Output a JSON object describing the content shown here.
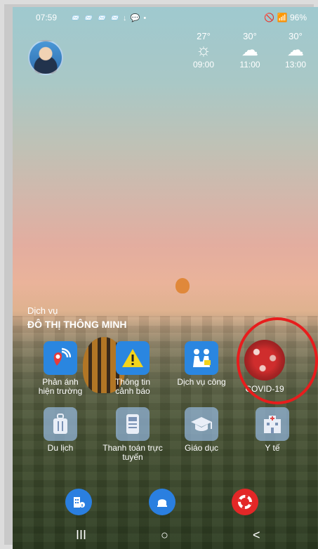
{
  "status_bar": {
    "time": "07:59",
    "notifications": "📨 📨 📨 📨 ↓ 💬 •",
    "right": "🚫 📶 96%"
  },
  "weather": [
    {
      "temp": "27°",
      "icon": "☼",
      "hour": "09:00"
    },
    {
      "temp": "30°",
      "icon": "☁",
      "hour": "11:00"
    },
    {
      "temp": "30°",
      "icon": "☁",
      "hour": "13:00"
    }
  ],
  "services": {
    "label": "Dịch vụ",
    "title": "ĐÔ THỊ THÔNG MINH",
    "row1": [
      {
        "label": "Phản ánh hiện trường",
        "icon": "location-signal-icon"
      },
      {
        "label": "Thông tin cảnh báo",
        "icon": "warning-icon"
      },
      {
        "label": "Dịch vụ công",
        "icon": "people-service-icon"
      },
      {
        "label": "COVID-19",
        "icon": "virus-icon"
      }
    ],
    "row2": [
      {
        "label": "Du lịch",
        "icon": "luggage-icon"
      },
      {
        "label": "Thanh toán trực tuyến",
        "icon": "payment-icon"
      },
      {
        "label": "Giáo dục",
        "icon": "graduation-cap-icon"
      },
      {
        "label": "Y tế",
        "icon": "hospital-icon"
      }
    ]
  },
  "bottom_buttons": [
    {
      "icon": "building-info-icon",
      "color": "#2a7fe0"
    },
    {
      "icon": "bell-icon",
      "color": "#2a7fe0"
    },
    {
      "icon": "lifebuoy-icon",
      "color": "#e32727"
    }
  ],
  "nav": {
    "recent": "III",
    "home": "○",
    "back": "<"
  }
}
